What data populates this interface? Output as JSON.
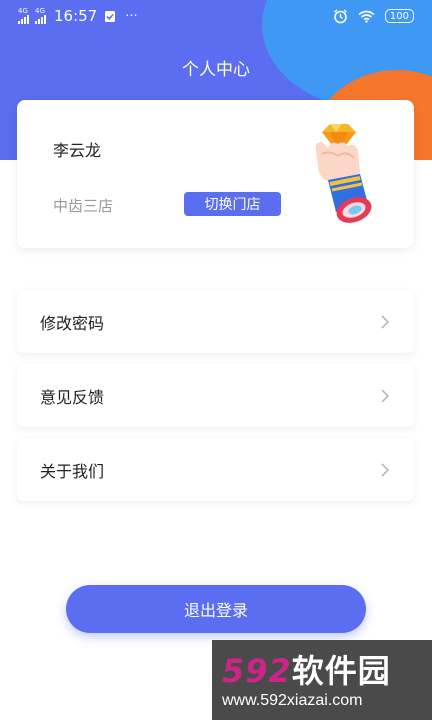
{
  "status_bar": {
    "net1": "4G",
    "net2": "4G",
    "time": "16:57",
    "more": "···",
    "battery": "100"
  },
  "header": {
    "title": "个人中心"
  },
  "profile": {
    "name": "李云龙",
    "store": "中齿三店",
    "switch_label": "切换门店"
  },
  "menu": [
    {
      "label": "修改密码"
    },
    {
      "label": "意见反馈"
    },
    {
      "label": "关于我们"
    }
  ],
  "logout_label": "退出登录",
  "watermark": {
    "logo_num": "592",
    "logo_cn": "软件园",
    "url": "www.592xiazai.com"
  },
  "colors": {
    "primary": "#5b6df0",
    "orange": "#f6762c",
    "blue": "#3aa0f5"
  }
}
